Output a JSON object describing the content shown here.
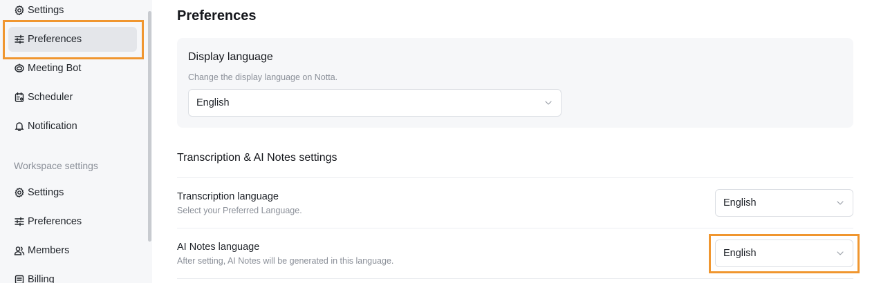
{
  "sidebar": {
    "items_top": [
      {
        "label": "Settings",
        "icon": "gear-icon"
      },
      {
        "label": "Preferences",
        "icon": "sliders-icon"
      },
      {
        "label": "Meeting Bot",
        "icon": "bot-icon"
      },
      {
        "label": "Scheduler",
        "icon": "calendar-icon"
      },
      {
        "label": "Notification",
        "icon": "bell-icon"
      }
    ],
    "workspace_label": "Workspace settings",
    "items_workspace": [
      {
        "label": "Settings",
        "icon": "gear-icon"
      },
      {
        "label": "Preferences",
        "icon": "sliders-icon"
      },
      {
        "label": "Members",
        "icon": "members-icon"
      },
      {
        "label": "Billing",
        "icon": "billing-icon"
      }
    ]
  },
  "main": {
    "title": "Preferences",
    "display_language": {
      "title": "Display language",
      "description": "Change the display language on Notta.",
      "value": "English"
    },
    "section_title": "Transcription & AI Notes settings",
    "transcription_language": {
      "title": "Transcription language",
      "description": "Select your Preferred Language.",
      "value": "English"
    },
    "ai_notes_language": {
      "title": "AI Notes language",
      "description": "After setting, AI Notes will be generated in this language.",
      "value": "English"
    }
  },
  "colors": {
    "highlight": "#f0962f",
    "sidebar_bg": "#f6f7f9",
    "active_item_bg": "#e4e6ea"
  }
}
